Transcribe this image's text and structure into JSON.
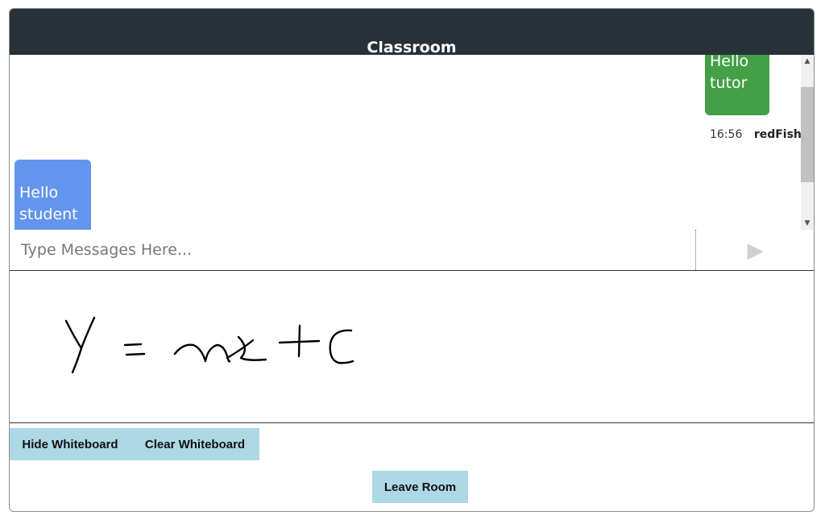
{
  "header": {
    "title": "Classroom"
  },
  "chat": {
    "messages": [
      {
        "text_line1": "Hello",
        "text_line2": "tutor",
        "time": "16:56",
        "user": "redFish",
        "color": "#43a047"
      },
      {
        "text_line1": "Hello",
        "text_line2": "student",
        "color": "#6495ed"
      }
    ],
    "input_placeholder": "Type Messages Here...",
    "input_value": "",
    "send_icon": "play-triangle-icon",
    "send_glyph": "▶"
  },
  "whiteboard": {
    "content": "Y = mx + C"
  },
  "buttons": {
    "hide_whiteboard": "Hide Whiteboard",
    "clear_whiteboard": "Clear Whiteboard",
    "leave_room": "Leave Room"
  },
  "colors": {
    "header_bg": "#263238",
    "button_bg": "#add8e6"
  }
}
